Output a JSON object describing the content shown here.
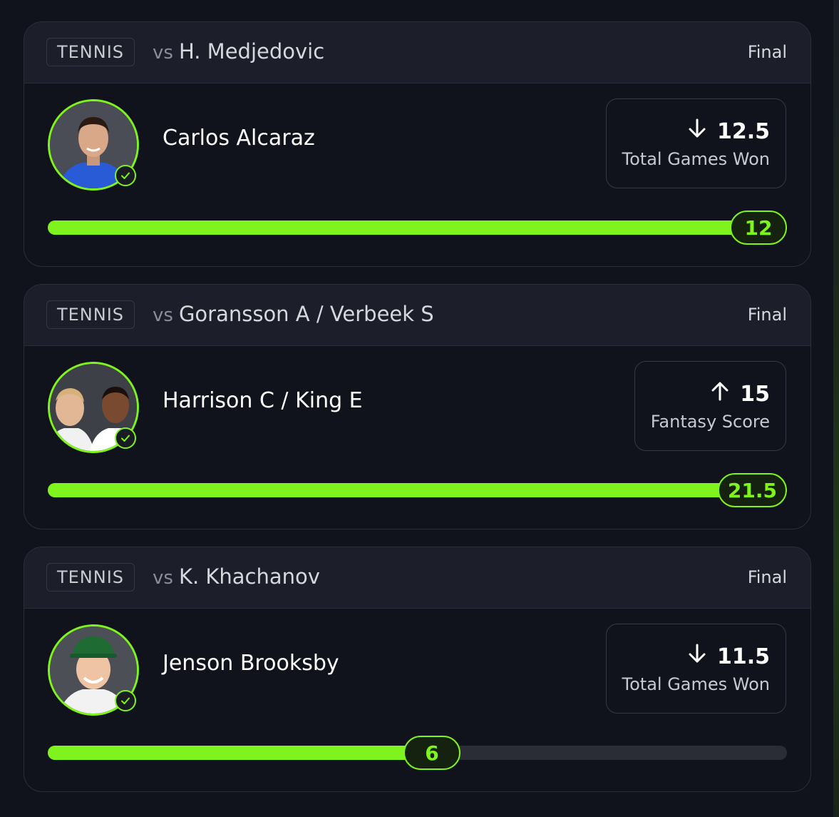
{
  "cards": [
    {
      "sport": "TENNIS",
      "vs_prefix": "vs",
      "opponent": "H. Medjedovic",
      "status": "Final",
      "player": "Carlos Alcaraz",
      "direction": "down",
      "direction_icon": "arrow-down-icon",
      "line": "12.5",
      "stat": "Total Games Won",
      "result": "12",
      "progress_fraction": 1.0
    },
    {
      "sport": "TENNIS",
      "vs_prefix": "vs",
      "opponent": "Goransson A / Verbeek S",
      "status": "Final",
      "player": "Harrison C / King E",
      "direction": "up",
      "direction_icon": "arrow-up-icon",
      "line": "15",
      "stat": "Fantasy Score",
      "result": "21.5",
      "progress_fraction": 1.0
    },
    {
      "sport": "TENNIS",
      "vs_prefix": "vs",
      "opponent": "K. Khachanov",
      "status": "Final",
      "player": "Jenson Brooksby",
      "direction": "down",
      "direction_icon": "arrow-down-icon",
      "line": "11.5",
      "stat": "Total Games Won",
      "result": "6",
      "progress_fraction": 0.52
    }
  ],
  "colors": {
    "accent": "#7ff31d",
    "background": "#11131c",
    "header": "#1c1e29",
    "border": "#2b2e3a",
    "track": "#2a2c36"
  }
}
